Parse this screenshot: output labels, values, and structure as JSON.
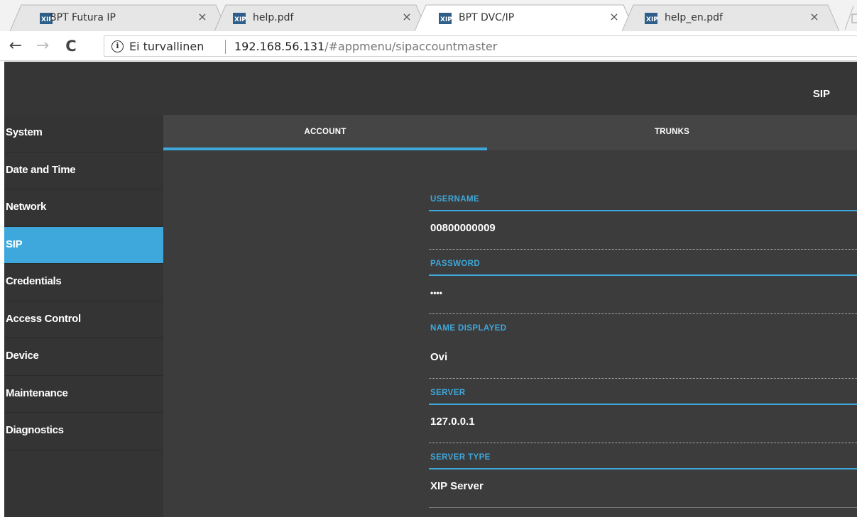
{
  "browser": {
    "tabs": [
      {
        "title": "BPT Futura IP",
        "active": false
      },
      {
        "title": "help.pdf",
        "active": false
      },
      {
        "title": "BPT DVC/IP",
        "active": true
      },
      {
        "title": "help_en.pdf",
        "active": false
      }
    ],
    "close_glyph": "×",
    "nav": {
      "back": "←",
      "forward": "→",
      "reload": "C"
    },
    "address": {
      "security_icon": "i",
      "security_text": "Ei turvallinen",
      "url_host": "192.168.56.131",
      "url_path": "/#appmenu/sipaccountmaster"
    }
  },
  "app": {
    "page_title": "SIP",
    "sidebar": {
      "items": [
        {
          "label": "System"
        },
        {
          "label": "Date and Time"
        },
        {
          "label": "Network"
        },
        {
          "label": "SIP",
          "active": true
        },
        {
          "label": "Credentials"
        },
        {
          "label": "Access Control"
        },
        {
          "label": "Device"
        },
        {
          "label": "Maintenance"
        },
        {
          "label": "Diagnostics"
        }
      ]
    },
    "tabs": [
      {
        "label": "ACCOUNT",
        "active": true
      },
      {
        "label": "TRUNKS",
        "active": false
      }
    ],
    "form": {
      "fields": [
        {
          "label": "USERNAME",
          "value": "00800000009"
        },
        {
          "label": "PASSWORD",
          "value": "••••"
        },
        {
          "label": "NAME DISPLAYED",
          "value": "Ovi"
        },
        {
          "label": "SERVER",
          "value": "127.0.0.1"
        },
        {
          "label": "SERVER TYPE",
          "value": "XIP Server"
        }
      ]
    },
    "colors": {
      "accent": "#3ea8dc",
      "background": "#3c3c3c",
      "sidebar": "#343434"
    }
  }
}
